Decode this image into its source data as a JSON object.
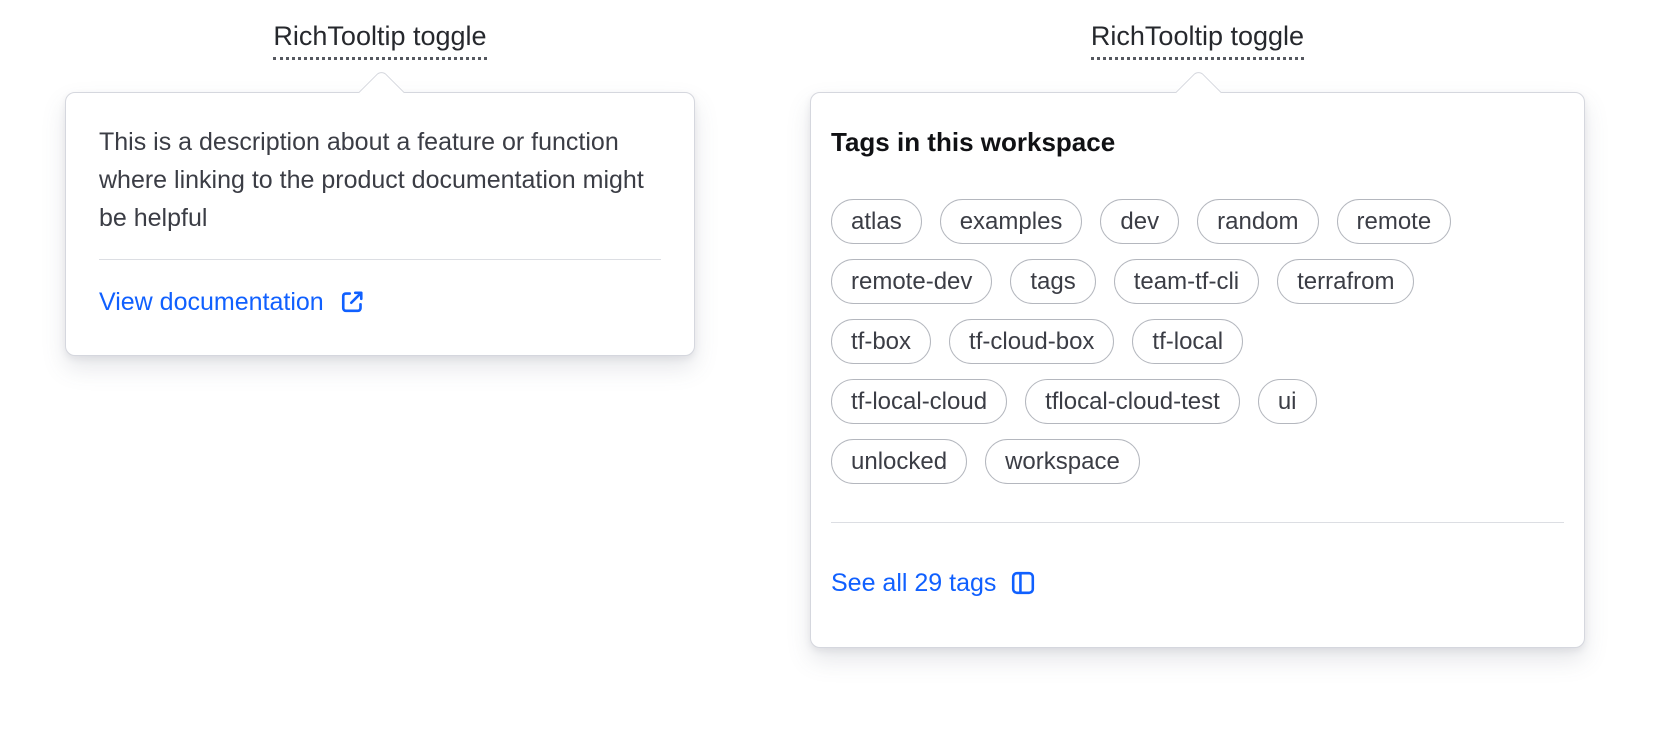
{
  "colors": {
    "accent_blue": "#1060ff"
  },
  "left_tooltip": {
    "toggle_label": "RichTooltip toggle",
    "description": "This is a description about a feature or function where linking to the product documentation might be helpful",
    "link_label": "View documentation",
    "link_icon": "external-link-icon"
  },
  "right_tooltip": {
    "toggle_label": "RichTooltip toggle",
    "heading": "Tags in this workspace",
    "tag_rows": [
      [
        "atlas",
        "examples",
        "dev",
        "random",
        "remote"
      ],
      [
        "remote-dev",
        "tags",
        "team-tf-cli",
        "terrafrom"
      ],
      [
        "tf-box",
        "tf-cloud-box",
        "tf-local"
      ],
      [
        "tf-local-cloud",
        "tflocal-cloud-test",
        "ui"
      ],
      [
        "unlocked",
        "workspace"
      ]
    ],
    "link_label": "See all 29 tags",
    "link_icon": "sidebar-icon"
  }
}
